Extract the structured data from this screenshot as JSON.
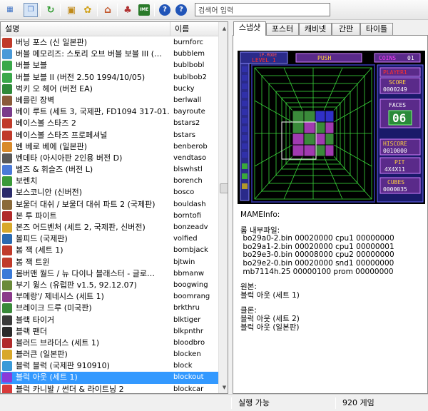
{
  "toolbar": {
    "buttons": [
      {
        "id": "view-large-icons",
        "icon": "grid-icon",
        "label": "▦",
        "color": "#3a6fc4",
        "pressed": false
      },
      {
        "id": "view-details",
        "icon": "details-view-icon",
        "label": "❐",
        "color": "#3a6fc4",
        "pressed": true
      },
      {
        "id": "refresh",
        "icon": "refresh-icon",
        "label": "↻",
        "color": "#2e9a2e",
        "pressed": false
      },
      {
        "id": "image",
        "icon": "picture-icon",
        "label": "▣",
        "color": "#c08a1a",
        "pressed": false
      },
      {
        "id": "settings",
        "icon": "cog-icon",
        "label": "✿",
        "color": "#d1a21a",
        "pressed": false
      },
      {
        "id": "home",
        "icon": "home-icon",
        "label": "⌂",
        "color": "#c2562a",
        "pressed": false
      },
      {
        "id": "play",
        "icon": "joystick-icon",
        "label": "♣",
        "color": "#b03030",
        "pressed": false
      },
      {
        "id": "ime",
        "icon": "ime-icon",
        "label": "IME",
        "color": "#2a7a2a",
        "pressed": false
      },
      {
        "id": "help",
        "icon": "help-icon",
        "label": "?",
        "color": "#2155b8",
        "pressed": false
      },
      {
        "id": "about",
        "icon": "info-icon",
        "label": "?",
        "color": "#2155b8",
        "pressed": false
      }
    ],
    "search_value": "검색어 입력"
  },
  "list": {
    "headers": {
      "description": "설명",
      "name": "이름"
    },
    "rows": [
      {
        "desc": "버닝 포스 (신 일본판)",
        "name": "burnforc",
        "icon_color": "#c03a2a"
      },
      {
        "desc": "버블 메모리즈: 스토리 오브 버블 보블 III (…",
        "name": "bubblem",
        "icon_color": "#4a9ad8"
      },
      {
        "desc": "버블 보블",
        "name": "bublbobl",
        "icon_color": "#3aa84a"
      },
      {
        "desc": "버블 보블 II (버전 2.50 1994/10/05)",
        "name": "bublbob2",
        "icon_color": "#3aa84a"
      },
      {
        "desc": "벅키 오 헤어 (버전 EA)",
        "name": "bucky",
        "icon_color": "#2f8a3a"
      },
      {
        "desc": "베를린 장벽",
        "name": "berlwall",
        "icon_color": "#8a5a3a"
      },
      {
        "desc": "베이 루트 (세트 3, 국제판, FD1094 317-01…",
        "name": "bayroute",
        "icon_color": "#7a3a8a"
      },
      {
        "desc": "베이스볼 스타즈 2",
        "name": "bstars2",
        "icon_color": "#c03a2a"
      },
      {
        "desc": "베이스볼 스타즈 프로페셔널",
        "name": "bstars",
        "icon_color": "#c03a2a"
      },
      {
        "desc": "벤 베로 베에 (일본판)",
        "name": "benberob",
        "icon_color": "#d88a2a"
      },
      {
        "desc": "벤데타 (아시아판 2인용 버전 D)",
        "name": "vendtaso",
        "icon_color": "#5a5a5a"
      },
      {
        "desc": "벨즈 & 휘슬즈 (버전 L)",
        "name": "blswhstl",
        "icon_color": "#4a7ad8"
      },
      {
        "desc": "보렌치",
        "name": "borench",
        "icon_color": "#3a9a3a"
      },
      {
        "desc": "보스코니안 (신버전)",
        "name": "bosco",
        "icon_color": "#2a2a6a"
      },
      {
        "desc": "보울더 대쉬 / 보울더 대쉬 파트 2 (국제판)",
        "name": "bouldash",
        "icon_color": "#8a6a3a"
      },
      {
        "desc": "본 투 파이트",
        "name": "borntofi",
        "icon_color": "#b02a2a"
      },
      {
        "desc": "본즈 어드벤처 (세트 2, 국제판, 신버전)",
        "name": "bonzeadv",
        "icon_color": "#d8a82a"
      },
      {
        "desc": "볼피드 (국제판)",
        "name": "volfied",
        "icon_color": "#2a6ab0"
      },
      {
        "desc": "봄 잭 (세트 1)",
        "name": "bombjack",
        "icon_color": "#c03a2a"
      },
      {
        "desc": "봄 잭 트윈",
        "name": "bjtwin",
        "icon_color": "#c03a2a"
      },
      {
        "desc": "봄버맨 월드 / 뉴 다이나 블래스터 - 글로…",
        "name": "bbmanw",
        "icon_color": "#3a7ad8"
      },
      {
        "desc": "부기 윙스 (유럽판 v1.5, 92.12.07)",
        "name": "boogwing",
        "icon_color": "#6a8a3a"
      },
      {
        "desc": "부메랑'/ 제네시스 (세트 1)",
        "name": "boomrang",
        "icon_color": "#8a3a8a"
      },
      {
        "desc": "브레이크 드루 (미국판)",
        "name": "brkthru",
        "icon_color": "#3a8a3a"
      },
      {
        "desc": "블랙 타이거",
        "name": "blktiger",
        "icon_color": "#3a3a3a"
      },
      {
        "desc": "블랙 팬더",
        "name": "blkpnthr",
        "icon_color": "#2a2a2a"
      },
      {
        "desc": "블러드 브라더스 (세트 1)",
        "name": "bloodbro",
        "icon_color": "#b02a2a"
      },
      {
        "desc": "블러큰 (일본판)",
        "name": "blocken",
        "icon_color": "#d8a82a"
      },
      {
        "desc": "블럭 블럭 (국제판 910910)",
        "name": "block",
        "icon_color": "#3a9ad8"
      },
      {
        "desc": "블럭 아웃 (세트 1)",
        "name": "blockout",
        "icon_color": "#8a3ad8",
        "selected": true
      },
      {
        "desc": "블럭 카니발 / 썬더 & 라이트닝 2",
        "name": "blockcar",
        "icon_color": "#d83a3a"
      }
    ]
  },
  "tabs": [
    {
      "label": "스냅샷",
      "active": true
    },
    {
      "label": "포스터",
      "active": false
    },
    {
      "label": "캐비넷",
      "active": false
    },
    {
      "label": "간판",
      "active": false
    },
    {
      "label": "타이틀",
      "active": false
    }
  ],
  "snapshot": {
    "mode_label": "1P-MODE",
    "level_label": "LEVEL 1",
    "push_label": "PUSH",
    "coins_label": "COINS",
    "coins_value": "01",
    "player_label": "PLAYER1",
    "score_label": "SCORE",
    "score_value": "0000249",
    "faces_label": "FACES",
    "faces_value": "06",
    "hiscore_label": "HISCORE",
    "hiscore_value": "0010000",
    "pit_label": "PIT",
    "pit_value": "4X4X11",
    "cubes_label": "CUBES",
    "cubes_value": "0000035"
  },
  "info": {
    "header": "MAMEInfo:",
    "rom_title": "롬 내부파일:",
    "rom_files": [
      " bo29a0-2.bin 00020000 cpu1 00000000",
      " bo29a1-2.bin 00020000 cpu1 00000001",
      " bo29e3-0.bin 00008000 cpu2 00000000",
      " bo29e2-0.bin 00020000 snd1 00000000",
      " mb7114h.25 00000100 prom 00000000"
    ],
    "original_title": "원본:",
    "original_value": "블럭 아웃 (세트 1)",
    "clones_title": "클론:",
    "clones": [
      "블럭 아웃 (세트 2)",
      "블럭 아웃 (일본판)"
    ]
  },
  "status": {
    "left": "",
    "state": "실행 가능",
    "count": "920 게임"
  }
}
